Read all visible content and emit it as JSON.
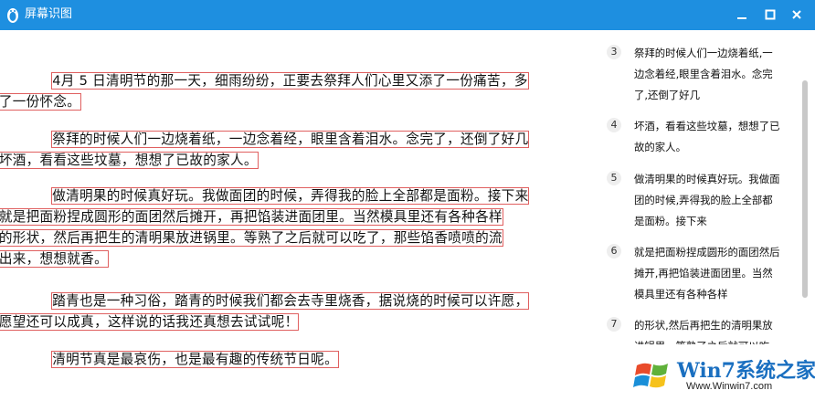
{
  "window": {
    "title": "屏幕识图",
    "minimize_icon": "minimize-icon",
    "maximize_icon": "maximize-icon",
    "close_icon": "close-icon",
    "titlebar_color": "#1e8fe0"
  },
  "document": {
    "paragraphs": [
      {
        "lines": [
          "4月 5 日清明节的那一天，细雨纷纷，正要去祭拜人们心里又添了一份痛苦，多",
          "了一份怀念。"
        ]
      },
      {
        "lines": [
          "祭拜的时候人们一边烧着纸，一边念着经，眼里含着泪水。念完了，还倒了好几",
          "坏酒，看看这些坟墓，想想了已故的家人。"
        ]
      },
      {
        "lines": [
          "做清明果的时候真好玩。我做面团的时候，弄得我的脸上全部都是面粉。接下来",
          "就是把面粉捏成圆形的面团然后摊开，再把馅装进面团里。当然模具里还有各种各样",
          "的形状，然后再把生的清明果放进锅里。等熟了之后就可以吃了，那些馅香喷喷的流",
          "出来，想想就香。"
        ]
      },
      {
        "lines": [
          "踏青也是一种习俗，踏青的时候我们都会去寺里烧香，据说烧的时候可以许愿，",
          "愿望还可以成真，这样说的话我还真想去试试呢！"
        ]
      },
      {
        "lines": [
          "清明节真是最哀伤，也是最有趣的传统节日呢。"
        ]
      }
    ]
  },
  "results": {
    "items": [
      {
        "num": "3",
        "lines": [
          "祭拜的时候人们一边烧着纸,一",
          "边念着经,眼里含着泪水。念完",
          "了,还倒了好几"
        ]
      },
      {
        "num": "4",
        "lines": [
          "坏酒，看看这些坟墓，想想了已",
          "故的家人。"
        ]
      },
      {
        "num": "5",
        "lines": [
          "做清明果的时候真好玩。我做面",
          "团的时候,弄得我的脸上全部都",
          "是面粉。接下来"
        ]
      },
      {
        "num": "6",
        "lines": [
          "就是把面粉捏成圆形的面团然后",
          "摊开,再把馅装进面团里。当然",
          "模具里还有各种各样"
        ]
      },
      {
        "num": "7",
        "lines": [
          "的形状,然后再把生的清明果放",
          "进锅里。等熟了之后就可以吃"
        ]
      }
    ]
  },
  "watermark": {
    "logo_icon": "windows-logo-icon",
    "big_text": "Win7系统之家",
    "small_text": "Www.Winwin7.com"
  }
}
